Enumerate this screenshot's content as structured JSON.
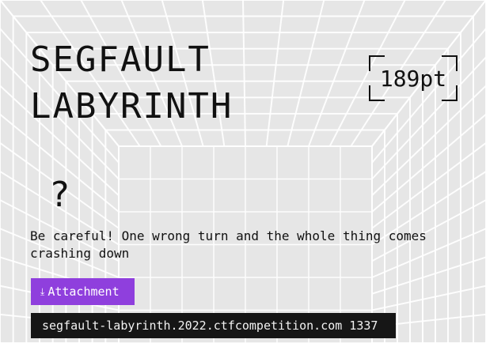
{
  "challenge": {
    "title_line1": "SEGFAULT",
    "title_line2": "LABYRINTH",
    "points": "189pt",
    "category_icon": "?",
    "description": "Be careful! One wrong turn and the whole thing comes crashing down",
    "attachment_label": "Attachment",
    "attachment_icon": "download-icon",
    "connection": "segfault-labyrinth.2022.ctfcompetition.com 1337"
  },
  "colors": {
    "background": "#e6e6e6",
    "grid_lines": "#ffffff",
    "text": "#111111",
    "attachment_button": "#8f3fdd",
    "connection_box": "#161616"
  }
}
